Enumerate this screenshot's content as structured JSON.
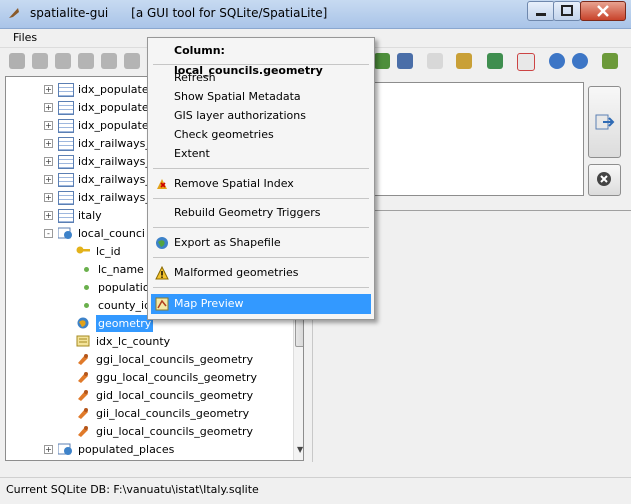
{
  "window": {
    "app_name": "spatialite-gui",
    "subtitle": "[a GUI tool for SQLite/SpatiaLite]"
  },
  "menubar": {
    "files": "Files"
  },
  "tree": {
    "rows": [
      "idx_populate",
      "idx_populate",
      "idx_populate",
      "idx_railways_",
      "idx_railways_",
      "idx_railways_",
      "idx_railways_",
      "italy",
      "local_counci",
      "lc_id",
      "lc_name",
      "populatio",
      "county_id",
      "geometry",
      "idx_lc_county",
      "ggi_local_councils_geometry",
      "ggu_local_councils_geometry",
      "gid_local_councils_geometry",
      "gii_local_councils_geometry",
      "giu_local_councils_geometry",
      "populated_places"
    ]
  },
  "context_menu": {
    "header": "Column: local_councils.geometry",
    "refresh": "Refresh",
    "show_spatial_metadata": "Show Spatial Metadata",
    "gis_layer_authorizations": "GIS layer authorizations",
    "check_geometries": "Check geometries",
    "extent": "Extent",
    "remove_spatial_index": "Remove Spatial Index",
    "rebuild_geometry_triggers": "Rebuild Geometry Triggers",
    "export_as_shapefile": "Export as Shapefile",
    "malformed_geometries": "Malformed geometries",
    "map_preview": "Map Preview"
  },
  "status": {
    "text": "Current SQLite DB: F:\\vanuatu\\istat\\Italy.sqlite"
  },
  "colors": {
    "selection": "#3399ff",
    "title_bar": "#b8cfee"
  }
}
